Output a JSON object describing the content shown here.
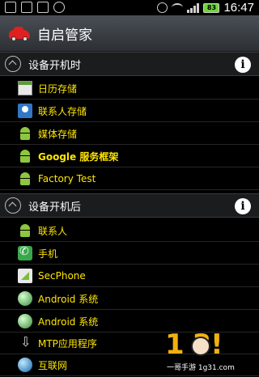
{
  "status_bar": {
    "battery": "83",
    "time": "16:47"
  },
  "app": {
    "title": "自启管家",
    "logo_icon": "red-car-icon"
  },
  "sections": [
    {
      "label": "设备开机时",
      "items": [
        {
          "label": "日历存储",
          "icon": "calendar-storage-icon",
          "bold": false
        },
        {
          "label": "联系人存储",
          "icon": "contacts-storage-icon",
          "bold": false
        },
        {
          "label": "媒体存储",
          "icon": "android-icon",
          "bold": false
        },
        {
          "label": "Google 服务框架",
          "icon": "android-icon",
          "bold": true
        },
        {
          "label": "Factory Test",
          "icon": "android-icon",
          "bold": false
        }
      ]
    },
    {
      "label": "设备开机后",
      "items": [
        {
          "label": "联系人",
          "icon": "android-icon",
          "bold": false
        },
        {
          "label": "手机",
          "icon": "phone-icon",
          "bold": false
        },
        {
          "label": "SecPhone",
          "icon": "secphone-icon",
          "bold": false
        },
        {
          "label": "Android 系统",
          "icon": "globe-icon",
          "bold": false
        },
        {
          "label": "Android 系统",
          "icon": "globe-icon",
          "bold": false
        },
        {
          "label": "MTP应用程序",
          "icon": "usb-icon",
          "bold": false
        },
        {
          "label": "互联网",
          "icon": "internet-icon",
          "bold": false
        }
      ]
    }
  ],
  "info_icon_glyph": "i",
  "watermark": {
    "glyphs": "1 3!",
    "caption": "一哥手游 1g31.com"
  },
  "colors": {
    "item_text": "#ffe600",
    "background": "#000000",
    "title_bar": "#3c4147"
  }
}
